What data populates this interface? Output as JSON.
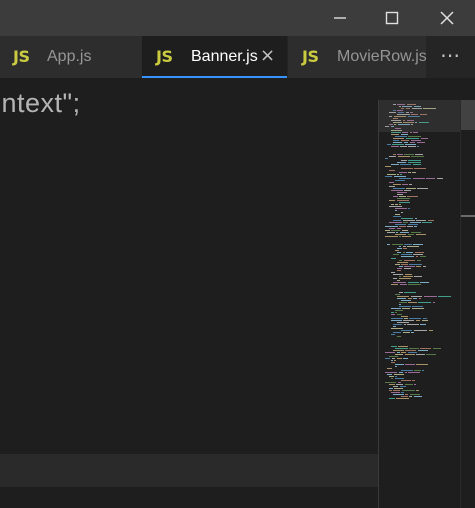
{
  "window": {
    "controls": [
      "minimize",
      "maximize",
      "close"
    ]
  },
  "tabs": [
    {
      "icon_text": "JS",
      "label": "App.js",
      "active": false
    },
    {
      "icon_text": "JS",
      "label": "Banner.js",
      "active": true,
      "close_glyph": "×"
    },
    {
      "icon_text": "JS",
      "label": "MovieRow.js",
      "active": false
    }
  ],
  "more_actions": "⋯",
  "editor": {
    "visible_code": "ontext\";"
  },
  "colors": {
    "js_icon": "#cbcb41",
    "active_tab_border": "#3794ff",
    "editor_bg": "#1e1e1e",
    "titlebar_bg": "#3c3c3c"
  }
}
